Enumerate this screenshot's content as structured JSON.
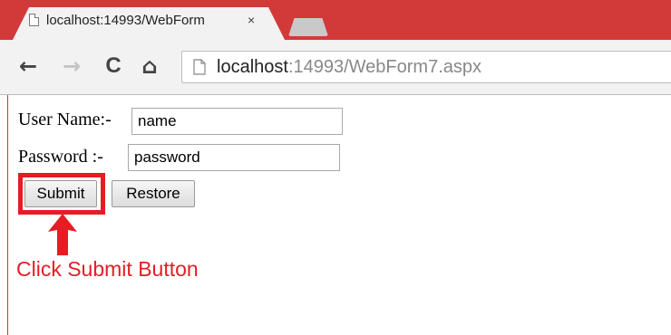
{
  "browser": {
    "tab": {
      "title": "localhost:14993/WebForm",
      "close_glyph": "×"
    },
    "toolbar": {
      "back_icon": "←",
      "forward_icon": "→",
      "reload_icon": "C",
      "home_icon": "⌂",
      "url_host": "localhost",
      "url_path": ":14993/WebForm7.aspx"
    },
    "accent_color": "#d23a3a"
  },
  "form": {
    "username_label": "User Name:-",
    "username_value": "name",
    "password_label": "Password :-",
    "password_value": "password",
    "submit_label": "Submit",
    "restore_label": "Restore"
  },
  "annotation": {
    "text": "Click Submit Button",
    "color": "#e41d25"
  }
}
